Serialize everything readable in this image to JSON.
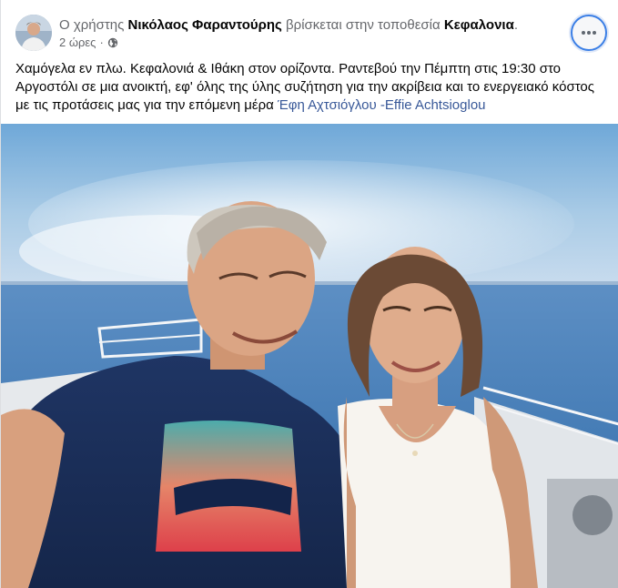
{
  "post": {
    "author_prefix": "Ο χρήστης",
    "author_name": "Νικόλαος Φαραντούρης",
    "location_prefix": "βρίσκεται στην τοποθεσία",
    "location": "Κεφαλονια",
    "location_suffix": ".",
    "time": "2 ώρες",
    "separator": "·",
    "privacy_icon": "globe-icon",
    "more_icon": "more-options-icon",
    "text": "Χαμόγελα εν πλω. Κεφαλονιά & Ιθάκη στον ορίζοντα. Ραντεβού την Πέμπτη στις 19:30 στο Αργοστόλι σε μια ανοικτή, εφ' όλης της ύλης συζήτηση για την ακρίβεια και το ενεργειακό κόστος με τις προτάσεις μας για την επόμενη μέρα",
    "mention": "Έφη Αχτσιόγλου -Effie Achtsioglou"
  },
  "colors": {
    "link": "#385898",
    "meta_text": "#65676b",
    "focus_ring": "#3b7fe6"
  }
}
